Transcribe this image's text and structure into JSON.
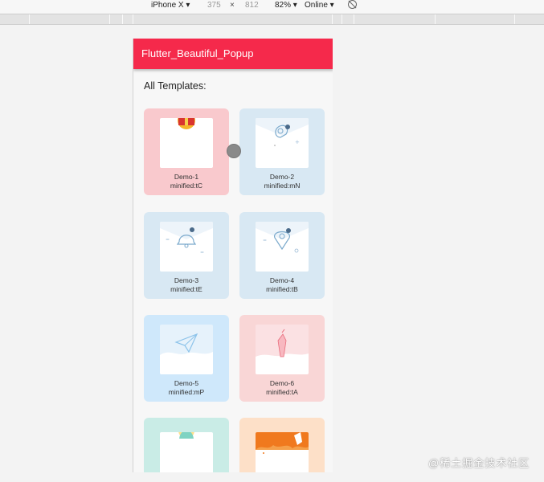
{
  "devtools": {
    "device": "iPhone X",
    "width": "375",
    "times": "×",
    "height": "812",
    "zoom": "82%",
    "network": "Online"
  },
  "app": {
    "title": "Flutter_Beautiful_Popup",
    "section_title": "All Templates:",
    "accent": "#f5294b"
  },
  "cards": [
    {
      "name": "Demo-1",
      "minified": "minified:tC",
      "color": "#f9c9cd"
    },
    {
      "name": "Demo-2",
      "minified": "minified:mN",
      "color": "#d8e8f3"
    },
    {
      "name": "Demo-3",
      "minified": "minified:tE",
      "color": "#d8e8f3"
    },
    {
      "name": "Demo-4",
      "minified": "minified:tB",
      "color": "#d8e8f3"
    },
    {
      "name": "Demo-5",
      "minified": "minified:mP",
      "color": "#cfe8fb"
    },
    {
      "name": "Demo-6",
      "minified": "minified:tA",
      "color": "#f9d6d6"
    },
    {
      "name": "",
      "minified": "",
      "color": "#c9ece6"
    },
    {
      "name": "",
      "minified": "",
      "color": "#fde0c8"
    }
  ],
  "watermark": "@稀土掘金技术社区"
}
